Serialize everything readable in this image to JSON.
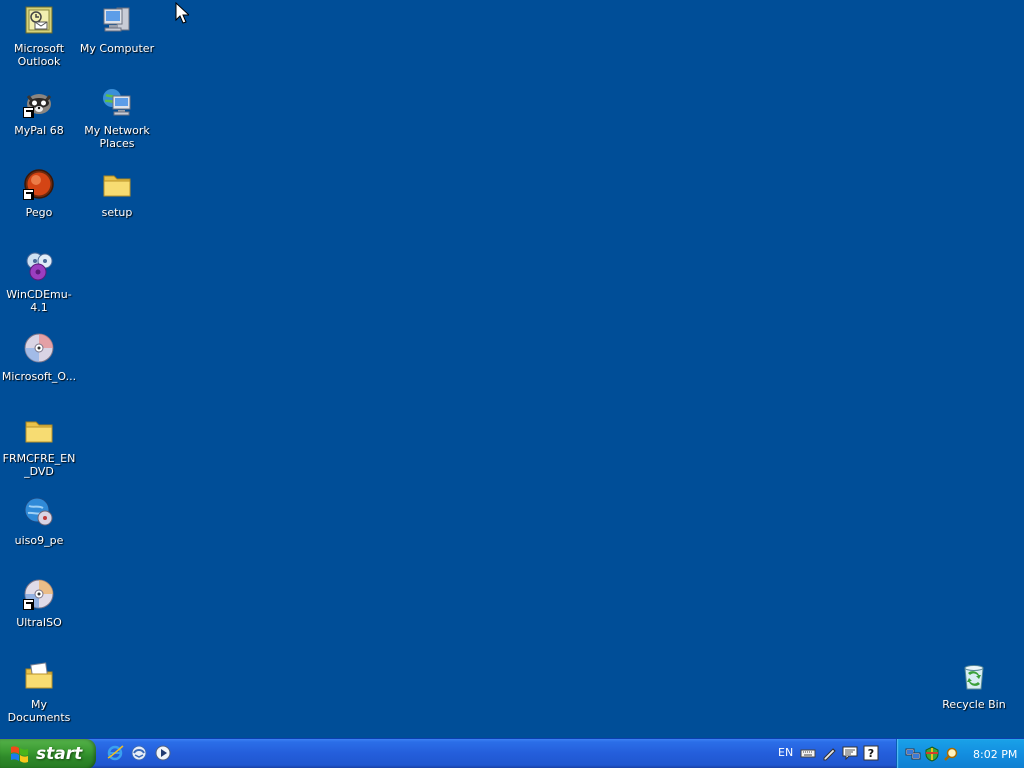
{
  "desktop": {
    "icons": [
      {
        "id": "microsoft-outlook",
        "label": "Microsoft Outlook",
        "icon": "outlook-icon",
        "shortcut": false
      },
      {
        "id": "my-computer",
        "label": "My Computer",
        "icon": "my-computer-icon",
        "shortcut": false
      },
      {
        "id": "mypal",
        "label": "MyPal 68",
        "icon": "mypal-icon",
        "shortcut": true
      },
      {
        "id": "my-network-places",
        "label": "My Network Places",
        "icon": "network-places-icon",
        "shortcut": false
      },
      {
        "id": "pego",
        "label": "Pego",
        "icon": "pego-icon",
        "shortcut": true
      },
      {
        "id": "setup",
        "label": "setup",
        "icon": "folder-icon",
        "shortcut": false
      },
      {
        "id": "wincdemu",
        "label": "WinCDEmu-4.1",
        "icon": "wincdemu-icon",
        "shortcut": false
      },
      {
        "id": "microsoft-o",
        "label": "Microsoft_O...",
        "icon": "disc-image-icon",
        "shortcut": false
      },
      {
        "id": "frmcfre",
        "label": "FRMCFRE_EN_DVD",
        "icon": "folder-icon",
        "shortcut": false
      },
      {
        "id": "uiso9-pe",
        "label": "uiso9_pe",
        "icon": "installer-disc-icon",
        "shortcut": false
      },
      {
        "id": "ultraiso",
        "label": "UltraISO",
        "icon": "ultraiso-icon",
        "shortcut": true
      },
      {
        "id": "my-documents",
        "label": "My Documents",
        "icon": "my-documents-icon",
        "shortcut": false
      },
      {
        "id": "recycle-bin",
        "label": "Recycle Bin",
        "icon": "recycle-bin-icon",
        "shortcut": false
      }
    ]
  },
  "taskbar": {
    "start_label": "start",
    "quick_launch": [
      "internet-explorer-icon",
      "outlook-express-icon",
      "media-player-icon"
    ],
    "language": "EN",
    "language_tools": [
      "keyboard-icon",
      "handwriting-pen-icon",
      "speech-icon",
      "help-icon"
    ],
    "tray_icons": [
      "network-connection-icon",
      "security-shield-icon",
      "search-icon"
    ],
    "clock": "8:02 PM"
  },
  "colors": {
    "desktop_background": "#004e98",
    "taskbar_blue": "#245edb",
    "start_green": "#3c9c33",
    "tray_blue": "#138ee0"
  }
}
